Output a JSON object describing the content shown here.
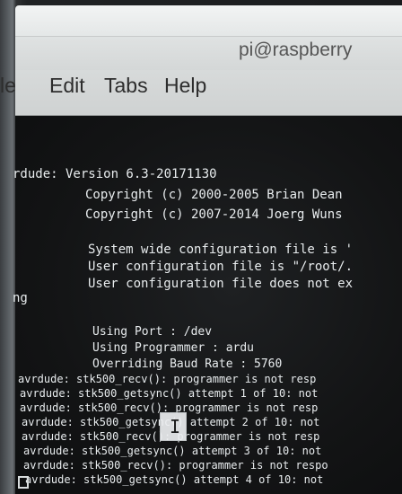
{
  "window": {
    "title": "pi@raspberry"
  },
  "menu": {
    "items": [
      "le",
      "Edit",
      "Tabs",
      "Help"
    ]
  },
  "terminal": {
    "lines": [
      "rdude: Version 6.3-20171130",
      "Copyright (c) 2000-2005 Brian Dean",
      "Copyright (c) 2007-2014 Joerg Wuns",
      "System wide configuration file is '",
      "User configuration file is \"/root/.",
      "User configuration file does not ex",
      "ng",
      "Using Port                    : /dev",
      "Using Programmer              : ardu",
      "Overriding Baud Rate          : 5760",
      "avrdude: stk500_recv(): programmer is not resp",
      "avrdude: stk500_getsync() attempt 1 of 10: not",
      "avrdude: stk500_recv(): programmer is not resp",
      "avrdude: stk500_getsync() attempt 2 of 10: not",
      "avrdude: stk500_recv(): programmer is not resp",
      "avrdude: stk500_getsync() attempt 3 of 10: not",
      "avrdude: stk500_recv(): programmer is not respo",
      "avrdude: stk500_getsync() attempt 4 of 10: not"
    ]
  },
  "cursor_glyph": "I"
}
